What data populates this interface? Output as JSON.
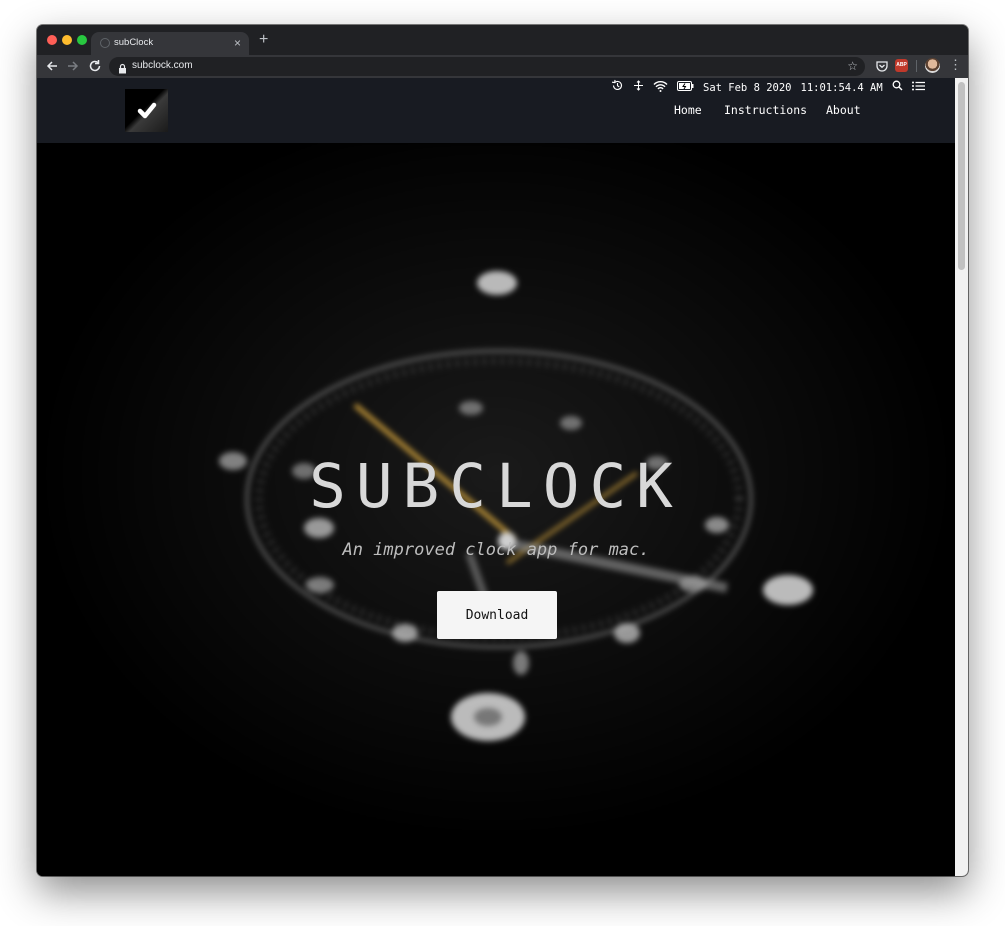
{
  "browser": {
    "tab_title": "subClock",
    "new_tab_symbol": "+",
    "close_symbol": "×",
    "url": "subclock.com",
    "abp_label": "ABP"
  },
  "menubar": {
    "date": "Sat Feb 8 2020",
    "time": "11:01:54.4 AM"
  },
  "nav": {
    "home": "Home",
    "instructions": "Instructions",
    "about": "About"
  },
  "hero": {
    "title": "SUBCLOCK",
    "subtitle": "An improved clock app for mac.",
    "download_label": "Download"
  }
}
